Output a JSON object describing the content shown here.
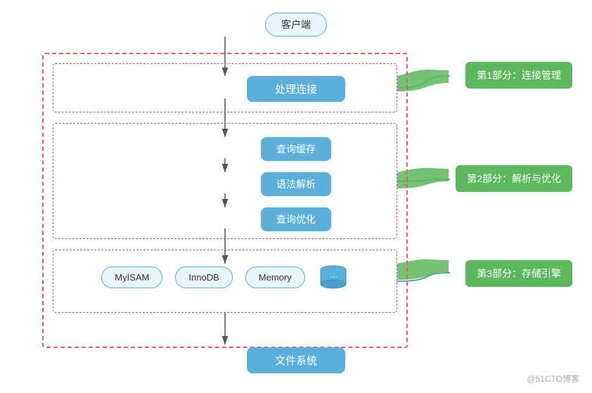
{
  "nodes": {
    "client": "客户端",
    "processConn": "处理连接",
    "queryCache": "查询缓存",
    "syntaxParse": "语法解析",
    "queryOpt": "查询优化",
    "engines": [
      "MyISAM",
      "InnoDB",
      "Memory",
      "..."
    ],
    "fileSystem": "文件系统"
  },
  "labels": {
    "part1": "第1部分：连接管理",
    "part2": "第2部分：解析与优化",
    "part3": "第3部分：存储引擎"
  },
  "watermark": "@51CTO博客"
}
